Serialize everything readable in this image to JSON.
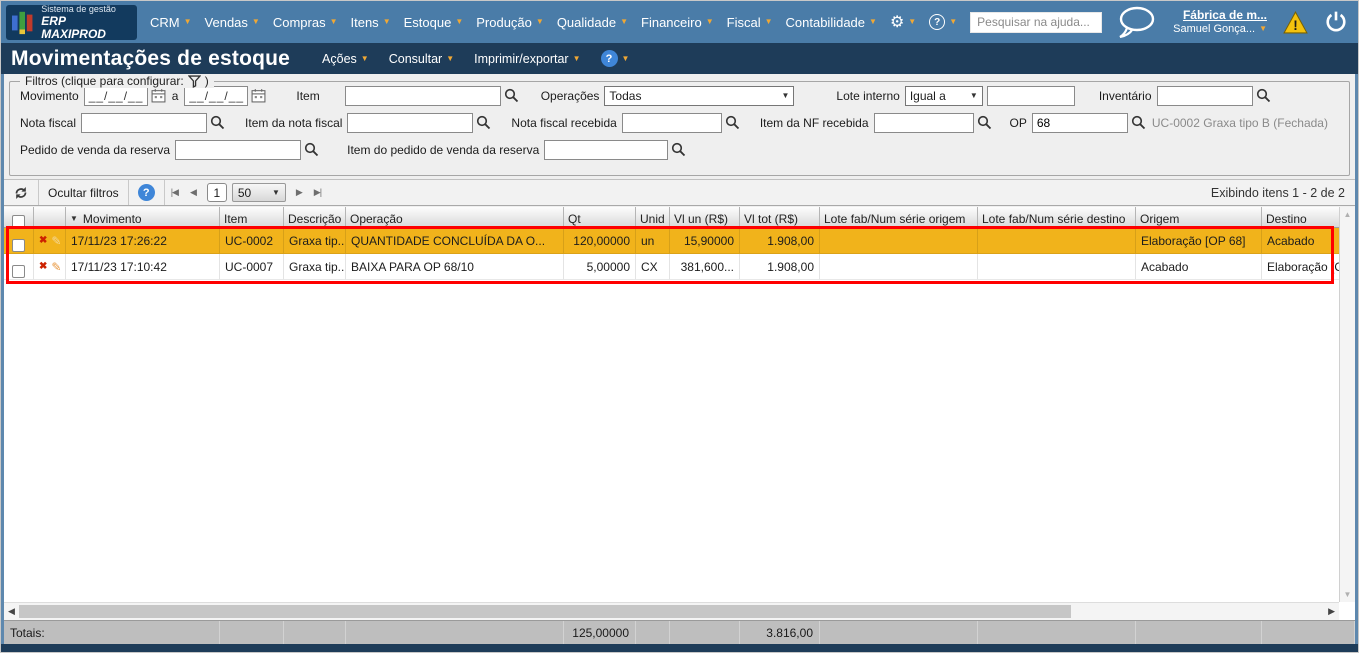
{
  "colors": {
    "topbar_bg": "#4A7CA8",
    "titlebar_bg": "#1E3C59",
    "accent_caret": "#F0A835",
    "row_highlight": "#F1B31B",
    "annotation_red": "#FF0000",
    "help_blue": "#3F86D8",
    "warning_yellow": "#F4C20D"
  },
  "icons": {
    "caret_down": "▼",
    "sort_desc": "▼",
    "delete_x": "✖",
    "edit_pencil": "✎",
    "gear": "⚙",
    "question": "?",
    "nav_first": "|◀",
    "nav_prev": "◀",
    "nav_next": "▶",
    "nav_last": "▶|",
    "scroll_left": "◀",
    "scroll_right": "▶",
    "scroll_up": "▲",
    "scroll_down": "▼",
    "legend_close": ")"
  },
  "topbar": {
    "logo_line1": "Sistema de gestão",
    "logo_line2": "ERP MAXIPROD",
    "menus": [
      "CRM",
      "Vendas",
      "Compras",
      "Itens",
      "Estoque",
      "Produção",
      "Qualidade",
      "Financeiro",
      "Fiscal",
      "Contabilidade"
    ],
    "search_placeholder": "Pesquisar na ajuda...",
    "account_link": "Fábrica de m...",
    "user_name": "Samuel Gonça..."
  },
  "titlebar": {
    "title": "Movimentações de estoque",
    "menu_acoes": "Ações",
    "menu_consultar": "Consultar",
    "menu_imprimir": "Imprimir/exportar"
  },
  "filters": {
    "legend": "Filtros (clique para configurar:",
    "movimento_label": "Movimento",
    "date_from_mask": "__/__/__",
    "date_to_mask": "__/__/__",
    "range_separator": "a",
    "item_label": "Item",
    "operacoes_label": "Operações",
    "operacoes_value": "Todas",
    "lote_interno_label": "Lote interno",
    "lote_interno_value": "Igual a",
    "inventario_label": "Inventário",
    "nota_fiscal_label": "Nota fiscal",
    "item_nota_fiscal_label": "Item da nota fiscal",
    "nota_fiscal_recebida_label": "Nota fiscal recebida",
    "item_nf_recebida_label": "Item da NF recebida",
    "op_label": "OP",
    "op_value": "68",
    "op_reference": "UC-0002 Graxa tipo B (Fechada)",
    "pedido_venda_label": "Pedido de venda da reserva",
    "item_pedido_venda_label": "Item do pedido de venda da reserva"
  },
  "toolbar": {
    "hide_filters_label": "Ocultar filtros",
    "page_number": "1",
    "page_size": "50",
    "items_info": "Exibindo itens 1 - 2 de 2"
  },
  "grid": {
    "headers": [
      "Movimento",
      "Item",
      "Descrição",
      "Operação",
      "Qt",
      "Unid",
      "Vl un (R$)",
      "Vl tot (R$)",
      "Lote fab/Num série origem",
      "Lote fab/Num série destino",
      "Origem",
      "Destino"
    ],
    "rows": [
      {
        "movimento": "17/11/23 17:26:22",
        "item": "UC-0002",
        "descricao": "Graxa tip...",
        "operacao": "QUANTIDADE CONCLUÍDA DA O...",
        "qt": "120,00000",
        "unid": "un",
        "vl_un": "15,90000",
        "vl_tot": "1.908,00",
        "lote_origem": "",
        "lote_destino": "",
        "origem": "Elaboração [OP 68]",
        "destino": "Acabado"
      },
      {
        "movimento": "17/11/23 17:10:42",
        "item": "UC-0007",
        "descricao": "Graxa tip...",
        "operacao": "BAIXA PARA OP 68/10",
        "qt": "5,00000",
        "unid": "CX",
        "vl_un": "381,600...",
        "vl_tot": "1.908,00",
        "lote_origem": "",
        "lote_destino": "",
        "origem": "Acabado",
        "destino": "Elaboração [O"
      }
    ],
    "totals_label": "Totais:",
    "totals_qt": "125,00000",
    "totals_vl_tot": "3.816,00"
  }
}
